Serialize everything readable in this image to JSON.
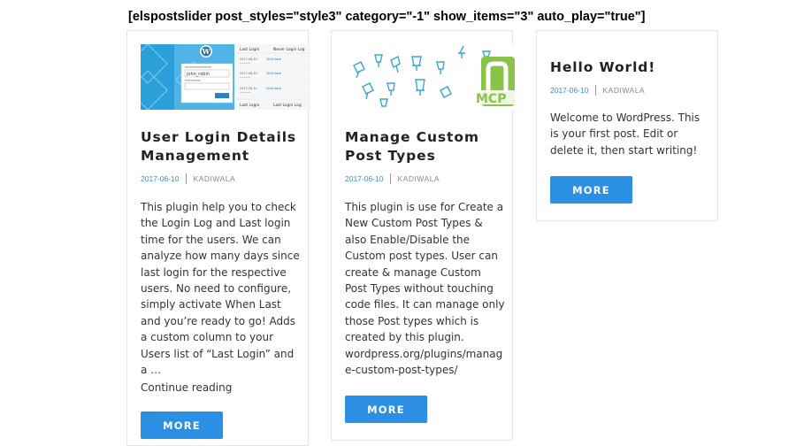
{
  "shortcode": "[elspostslider post_styles=\"style3\" category=\"-1\" show_items=\"3\" auto_play=\"true\"]",
  "colors": {
    "accent": "#2b8fe3",
    "date": "#3b8fd8",
    "border": "#e6e6e6"
  },
  "posts": [
    {
      "title": "User Login Details Management",
      "date": "2017-06-10",
      "author": "KADIWALA",
      "excerpt": "This plugin help you to check the Login Log and Last login time for the users. We can analyze how many days since last login for the respective users. No need to configure, simply activate When Last and you’re ready to go! Adds a custom column to your Users list of “Last Login” and a …",
      "continue": "Continue reading",
      "more": "MORE",
      "thumb": {
        "wp_logo": "W",
        "username_value": "john_robin",
        "columns": [
          "Last Login",
          "Never Login Log"
        ],
        "rows": [
          [
            "2017-06-10",
            "Click here"
          ],
          [
            "2017-06-10",
            "Click here"
          ],
          [
            "2017-06-10",
            "Click here"
          ]
        ],
        "footer": [
          "Last Login",
          "Last Login Log"
        ]
      }
    },
    {
      "title": "Manage Custom Post Types",
      "date": "2017-06-10",
      "author": "KADIWALA",
      "excerpt": "This plugin is use for Create a New Custom Post Types & also Enable/Disable the Custom post types. User can create & manage Custom Post Types without touching code files. It can manage only those Post types which is created by this plugin. wordpress.org/plugins/manage-custom-post-types/",
      "more": "MORE",
      "thumb": {
        "badge_text": "MCP"
      }
    },
    {
      "title": "Hello World!",
      "date": "2017-06-10",
      "author": "KADIWALA",
      "excerpt": "Welcome to WordPress. This is your first post. Edit or delete it, then start writing!",
      "more": "MORE"
    }
  ]
}
